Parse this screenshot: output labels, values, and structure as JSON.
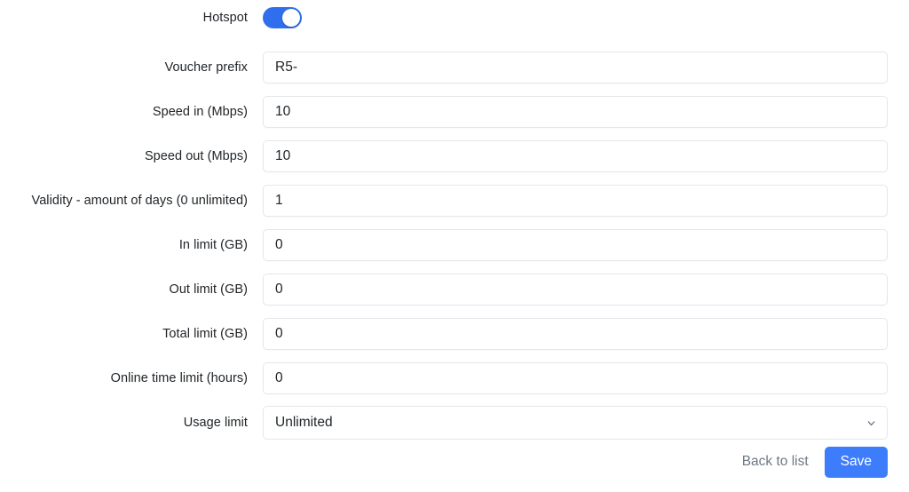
{
  "form": {
    "rows": [
      {
        "label": "Hotspot",
        "type": "toggle",
        "value": "on",
        "name": "hotspot"
      },
      {
        "label": "Voucher prefix",
        "type": "text",
        "value": "R5-",
        "name": "voucher-prefix"
      },
      {
        "label": "Speed in (Mbps)",
        "type": "text",
        "value": "10",
        "name": "speed-in"
      },
      {
        "label": "Speed out (Mbps)",
        "type": "text",
        "value": "10",
        "name": "speed-out"
      },
      {
        "label": "Validity - amount of days (0 unlimited)",
        "type": "text",
        "value": "1",
        "name": "validity-days"
      },
      {
        "label": "In limit (GB)",
        "type": "text",
        "value": "0",
        "name": "in-limit"
      },
      {
        "label": "Out limit (GB)",
        "type": "text",
        "value": "0",
        "name": "out-limit"
      },
      {
        "label": "Total limit (GB)",
        "type": "text",
        "value": "0",
        "name": "total-limit"
      },
      {
        "label": "Online time limit (hours)",
        "type": "text",
        "value": "0",
        "name": "online-time-limit"
      },
      {
        "label": "Usage limit",
        "type": "select",
        "value": "Unlimited",
        "name": "usage-limit"
      }
    ]
  },
  "footer": {
    "back_label": "Back to list",
    "save_label": "Save"
  },
  "icons": {
    "chevron_down": "chevron-down-icon"
  },
  "colors": {
    "accent": "#3d7dfc",
    "toggle_on": "#2f6fed",
    "label_text": "#212529",
    "muted_text": "#6e7884",
    "input_border": "#e3e6ea",
    "page_background": "#ffffff"
  }
}
